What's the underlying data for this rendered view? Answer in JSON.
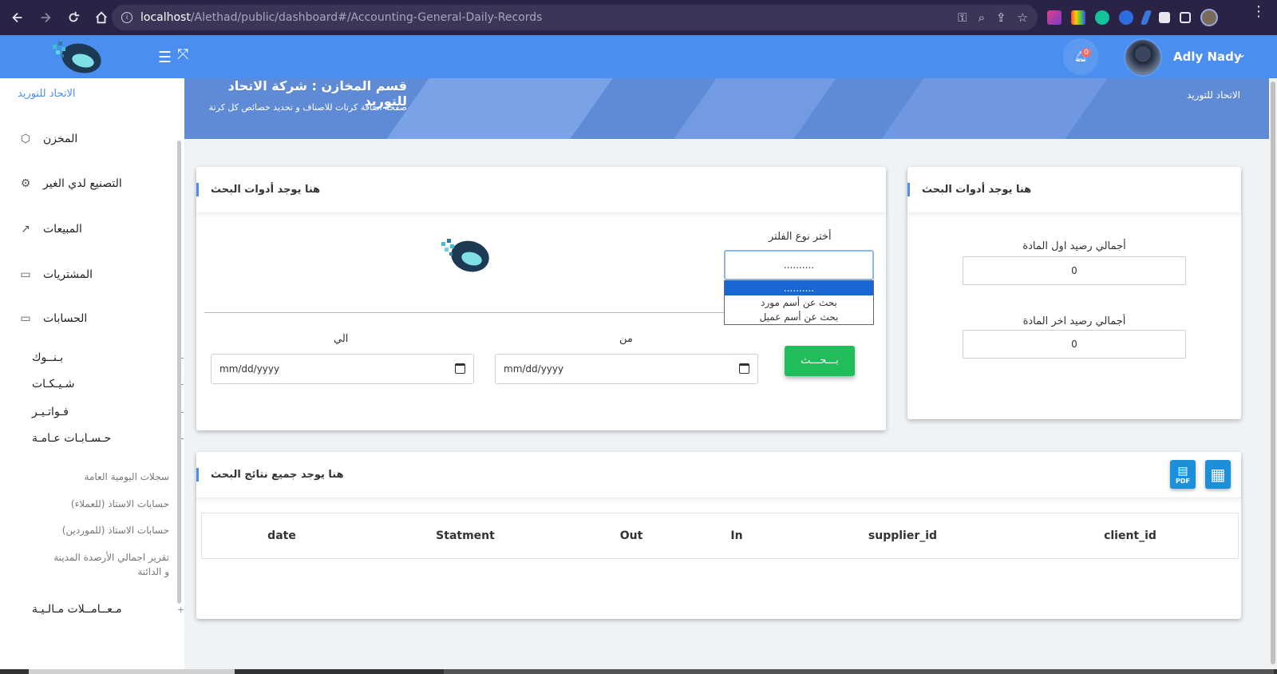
{
  "browser": {
    "url_host": "localhost",
    "url_path": "/Alethad/public/dashboard#/Accounting-General-Daily-Records"
  },
  "header": {
    "notifications_count": "0",
    "user_name": "Adly Nady"
  },
  "sidebar": {
    "brand": "الاتحاد للتوريد",
    "items": [
      {
        "label": "المخزن",
        "icon": "box-icon"
      },
      {
        "label": "التصنيع لدي الغير",
        "icon": "gear-icon"
      },
      {
        "label": "المبيعات",
        "icon": "trend-icon"
      },
      {
        "label": "المشتريات",
        "icon": "card-icon"
      },
      {
        "label": "الحسابات",
        "icon": "card-icon"
      }
    ],
    "subitems": [
      "بـنــوك",
      "شـيـكـات",
      "فـواتـيـر",
      "حـسـابـات عـامـة",
      "مـعــامــلات مـالـيـة"
    ],
    "general_accounts": [
      "سجلات اليومية العامة",
      "حسابات الاستاذ (للعملاء)",
      "حسابات الاستاذ (للموردين)",
      "تقرير اجمالي الأرصدة المدينة و الدائنة"
    ]
  },
  "banner": {
    "title": "قسم المخازن : شركة الاتحاد للتوريد",
    "subtitle": "صفحة اضافة كرتات للاصناف و تحديد خصائص كل كرتة",
    "right_text": "الاتحاد للتوريد"
  },
  "search_card": {
    "title": "هنا يوجد أدوات البحث",
    "filter_label": "أختر نوع الفلتر",
    "filter_value": "..........",
    "filter_options": [
      "..........",
      "بحث عن أسم مورد",
      "بحث عن أسم عميل"
    ],
    "from_label": "من",
    "to_label": "الي",
    "date_placeholder": "mm/dd/yyyy",
    "search_button": "بـــحـــث"
  },
  "balance_card": {
    "title": "هنا يوجد أدوات البحث",
    "first_balance_label": "أجمالي رصيد اول المادة",
    "first_balance_value": "0",
    "last_balance_label": "أجمالي رصيد اخر المادة",
    "last_balance_value": "0"
  },
  "results_card": {
    "title": "هنا يوجد جميع نتائج البحث",
    "pdf_label": "PDF",
    "columns": [
      "date",
      "Statment",
      "Out",
      "In",
      "supplier_id",
      "client_id"
    ]
  }
}
